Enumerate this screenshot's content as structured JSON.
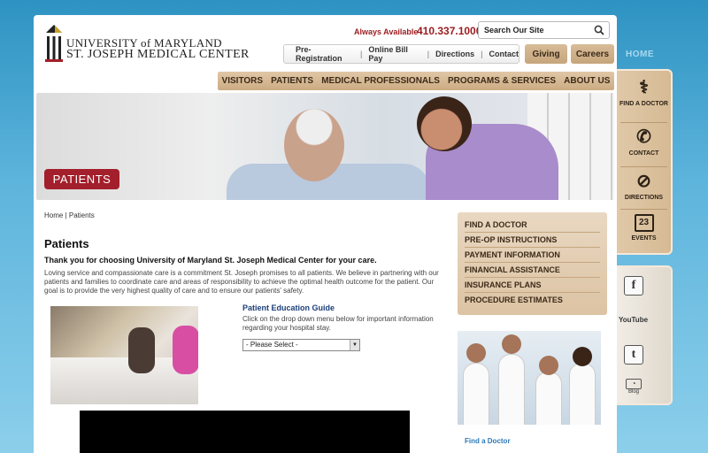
{
  "header": {
    "logo_line1": "UNIVERSITY of MARYLAND",
    "logo_line2": "ST. JOSEPH MEDICAL CENTER",
    "always_available": "Always Available",
    "phone": "410.337.1000",
    "search_placeholder": "Search Our Site",
    "util_links": [
      "Pre-Registration",
      "Online Bill Pay",
      "Directions",
      "Contact"
    ],
    "giving": "Giving",
    "careers": "Careers",
    "home": "HOME"
  },
  "nav": [
    "VISITORS",
    "PATIENTS",
    "MEDICAL PROFESSIONALS",
    "PROGRAMS & SERVICES",
    "ABOUT US"
  ],
  "hero": {
    "label": "PATIENTS"
  },
  "breadcrumb": "Home | Patients",
  "main": {
    "title": "Patients",
    "lead": "Thank you for choosing University of Maryland St. Joseph Medical Center for your care.",
    "body": "Loving service and compassionate care is a commitment St. Joseph promises to all patients. We believe in partnering with our patients and families to coordinate care and areas of responsibility to achieve the optimal health outcome for the patient. Our goal is to provide the very highest quality of care and to ensure our patients' safety.",
    "edu_title": "Patient Education Guide",
    "edu_text": "Click on the drop down menu below for important information regarding your hospital stay.",
    "select_value": "- Please Select -"
  },
  "quick_links": [
    "FIND A DOCTOR",
    "PRE-OP INSTRUCTIONS",
    "PAYMENT INFORMATION",
    "FINANCIAL ASSISTANCE",
    "INSURANCE PLANS",
    "PROCEDURE ESTIMATES"
  ],
  "find_doctor_caption": "Find a Doctor",
  "side_tools": [
    {
      "label": "FIND A DOCTOR",
      "icon": "stethoscope-icon"
    },
    {
      "label": "CONTACT",
      "icon": "phone-icon"
    },
    {
      "label": "DIRECTIONS",
      "icon": "compass-icon"
    },
    {
      "label": "EVENTS",
      "icon": "calendar-icon",
      "day": "23"
    }
  ],
  "social": {
    "facebook": "f",
    "youtube": "YouTube",
    "twitter": "t",
    "blog": "Blog"
  },
  "colors": {
    "brand_red": "#a31f2b",
    "tan": "#d6ba94",
    "link_blue": "#2d79b8"
  }
}
